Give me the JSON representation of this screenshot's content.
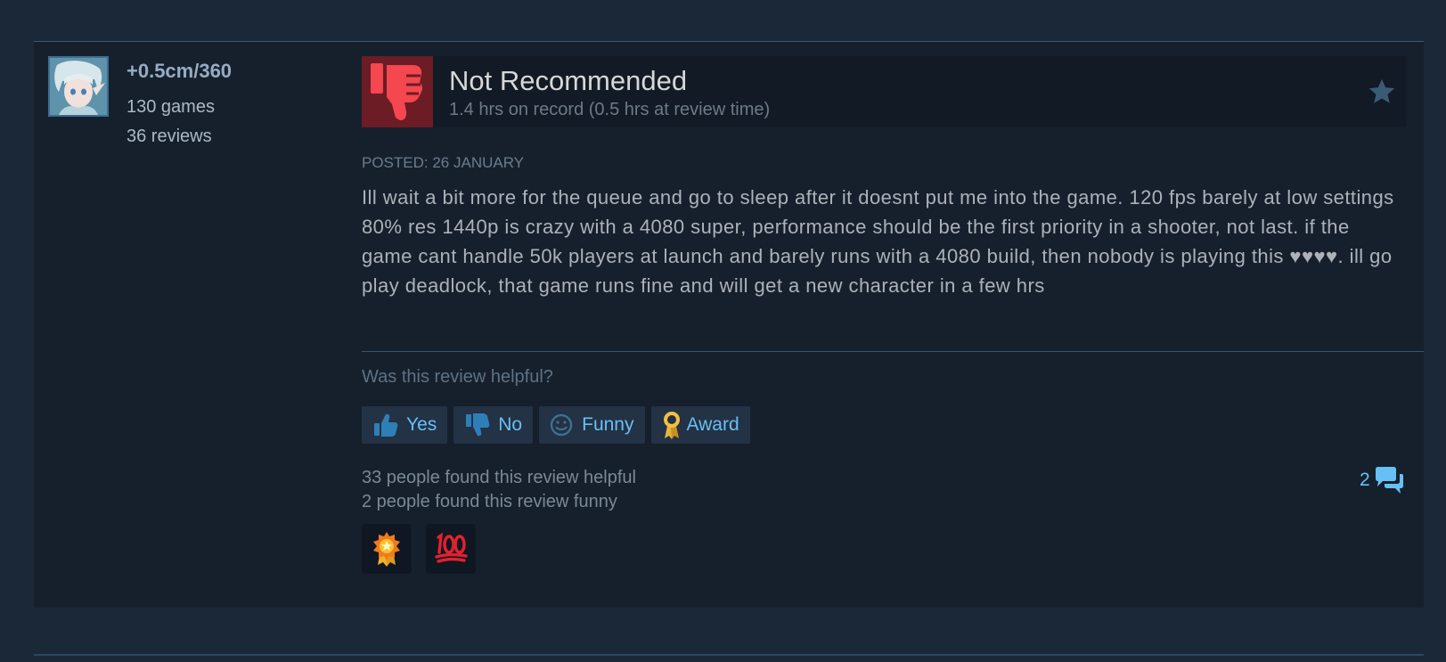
{
  "author": {
    "name": "+0.5cm/360",
    "games": "130 games",
    "reviews": "36 reviews"
  },
  "review": {
    "verdict": "Not Recommended",
    "hours": "1.4 hrs on record (0.5 hrs at review time)",
    "posted": "POSTED: 26 JANUARY",
    "body": "Ill wait a bit more for the queue and go to sleep after it doesnt put me into the game. 120 fps barely at low settings 80% res 1440p is crazy with a 4080 super, performance should be the first priority in a shooter, not last. if the game cant handle 50k players at launch and barely runs with a 4080 build, then nobody is playing this ♥♥♥♥. ill go play deadlock, that game runs fine and will get a new character in a few hrs"
  },
  "feedback": {
    "question": "Was this review helpful?",
    "buttons": {
      "yes": "Yes",
      "no": "No",
      "funny": "Funny",
      "award": "Award"
    },
    "helpful_count": "33 people found this review helpful",
    "funny_count": "2 people found this review funny",
    "comments": "2"
  },
  "awards": [
    "award-medal-icon",
    "hundred-points-icon"
  ],
  "icons": {
    "verdict": "thumbs-down-icon",
    "favorite": "star-icon",
    "comments": "speech-bubble-icon"
  },
  "colors": {
    "background": "#1b2838",
    "card": "#16202d",
    "link_blue": "#66c0f4",
    "not_recommended_red": "#6b1c25"
  }
}
